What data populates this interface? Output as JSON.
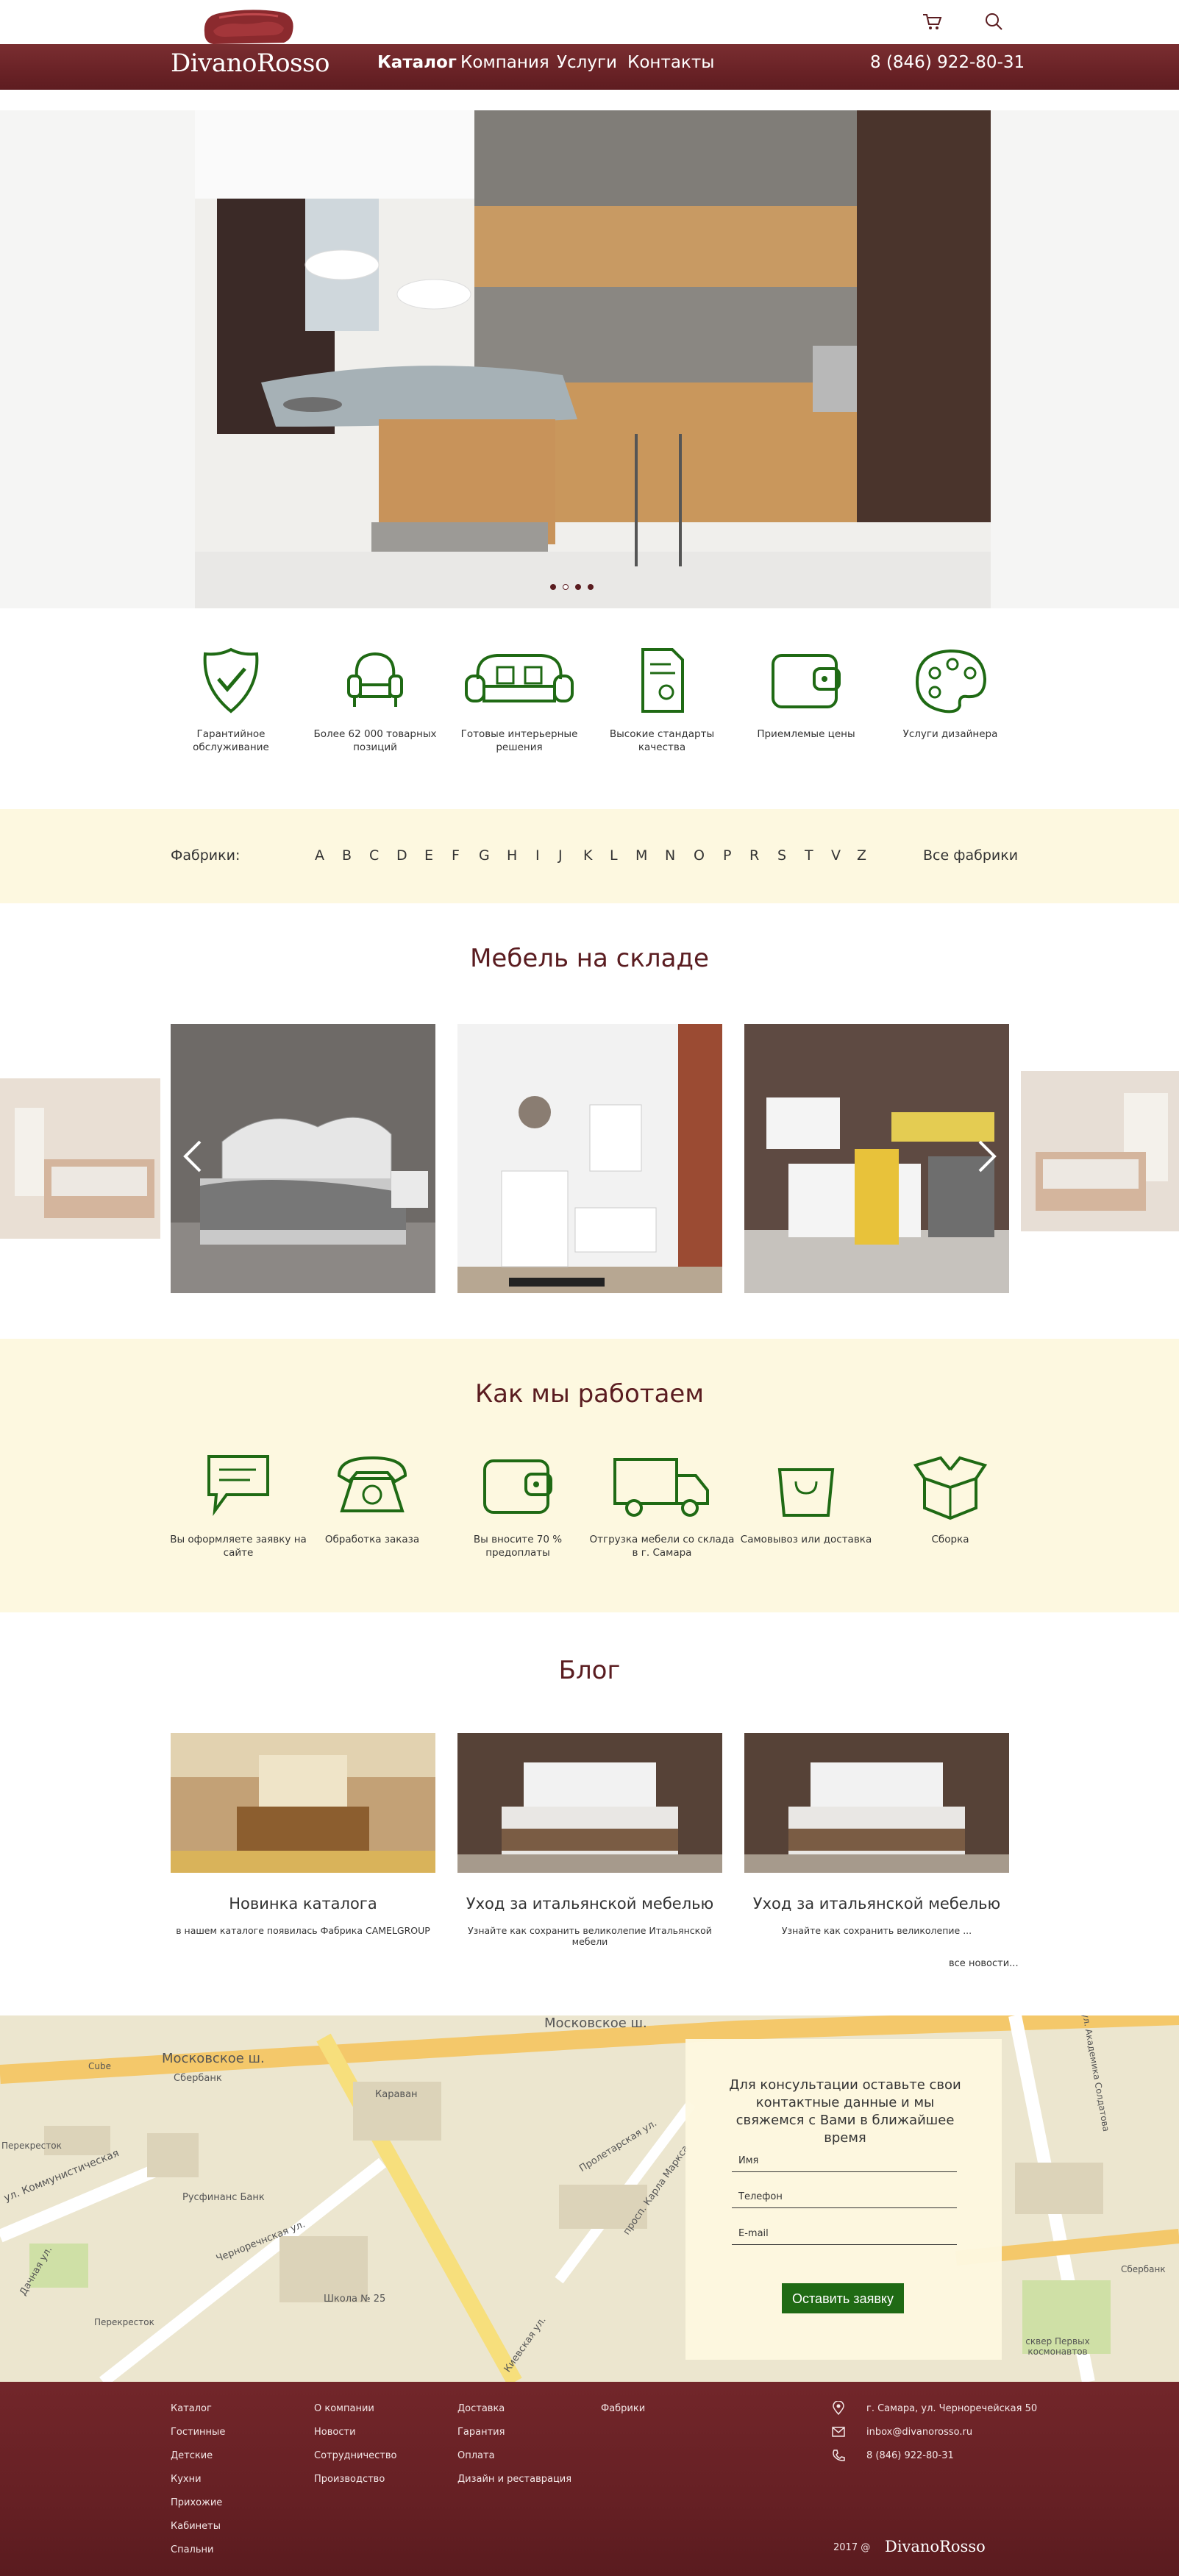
{
  "brand": {
    "name": "DivanoRosso"
  },
  "header": {
    "nav": [
      "Каталог",
      "Компания",
      "Услуги",
      "Контакты"
    ],
    "phone": "8 (846) 922-80-31",
    "icons": [
      "cart-icon",
      "search-icon"
    ]
  },
  "hero": {
    "slides": 4,
    "active_slide": 2
  },
  "features": [
    "Гарантийное обслуживание",
    "Более 62 000 товарных позиций",
    "Готовые интерьерные решения",
    "Высокие стандарты качества",
    "Приемлемые цены",
    "Услуги дизайнера"
  ],
  "factories": {
    "label": "Фабрики:",
    "letters": [
      "A",
      "B",
      "C",
      "D",
      "E",
      "F",
      "G",
      "H",
      "I",
      "J",
      "K",
      "L",
      "M",
      "N",
      "O",
      "P",
      "R",
      "S",
      "T",
      "V",
      "Z"
    ],
    "all": "Все фабрики"
  },
  "stock": {
    "title": "Мебель на складе"
  },
  "how": {
    "title": "Как мы работаем",
    "steps": [
      "Вы оформляете заявку на сайте",
      "Обработка заказа",
      "Вы вносите 70 % предоплаты",
      "Отгрузка мебели со склада в г. Самара",
      "Самовывоз или доставка",
      "Сборка"
    ]
  },
  "blog": {
    "title": "Блог",
    "posts": [
      {
        "title": "Новинка каталога",
        "text": "в нашем каталоге появилась Фабрика CAMELGROUP"
      },
      {
        "title": "Уход за итальянской мебелью",
        "text": "Узнайте как сохранить великолепие Итальянской мебели"
      },
      {
        "title": "Уход за итальянской мебелью",
        "text": "Узнайте как сохранить великолепие ..."
      }
    ],
    "more": "все новости..."
  },
  "map": {
    "labels": [
      "Московское ш.",
      "Московское ш.",
      "Сбербанк",
      "Караван",
      "Русфинанс Банк",
      "Перекресток",
      "Школа № 25",
      "Черноречнская ул.",
      "Киевская ул.",
      "Пролетарская ул.",
      "просп. Карла Маркса",
      "ул. Коммунистическая",
      "Дачная ул.",
      "ул. Академика Солдатова",
      "Сбербанк",
      "сквер Первых космонавтов",
      "Cube",
      "Перекресток"
    ]
  },
  "form": {
    "title": "Для консультации оставьте свои контактные данные и мы свяжемся с Вами в ближайшее время",
    "fields": [
      "Имя",
      "Телефон",
      "E-mail"
    ],
    "submit": "Оставить заявку"
  },
  "footer": {
    "col1": [
      "Каталог",
      "Гостинные",
      "Детские",
      "Кухни",
      "Прихожие",
      "Кабинеты",
      "Спальни"
    ],
    "col2": [
      "О компании",
      "Новости",
      "Сотрудничество",
      "Производство"
    ],
    "col3": [
      "Доставка",
      "Гарантия",
      "Оплата",
      "Дизайн и реставрация"
    ],
    "col4": [
      "Фабрики"
    ],
    "address": "г. Самара, ул. Черноречейская 50",
    "email": "inbox@divanorosso.ru",
    "phone": "8 (846) 922-80-31",
    "copyright": "2017 @",
    "logo": "DivanoRosso"
  },
  "colors": {
    "brand_dark_red": "#6b2327",
    "title_red": "#5a1c20",
    "cream": "#fdf8e0",
    "green_icon": "#1f6a14"
  }
}
